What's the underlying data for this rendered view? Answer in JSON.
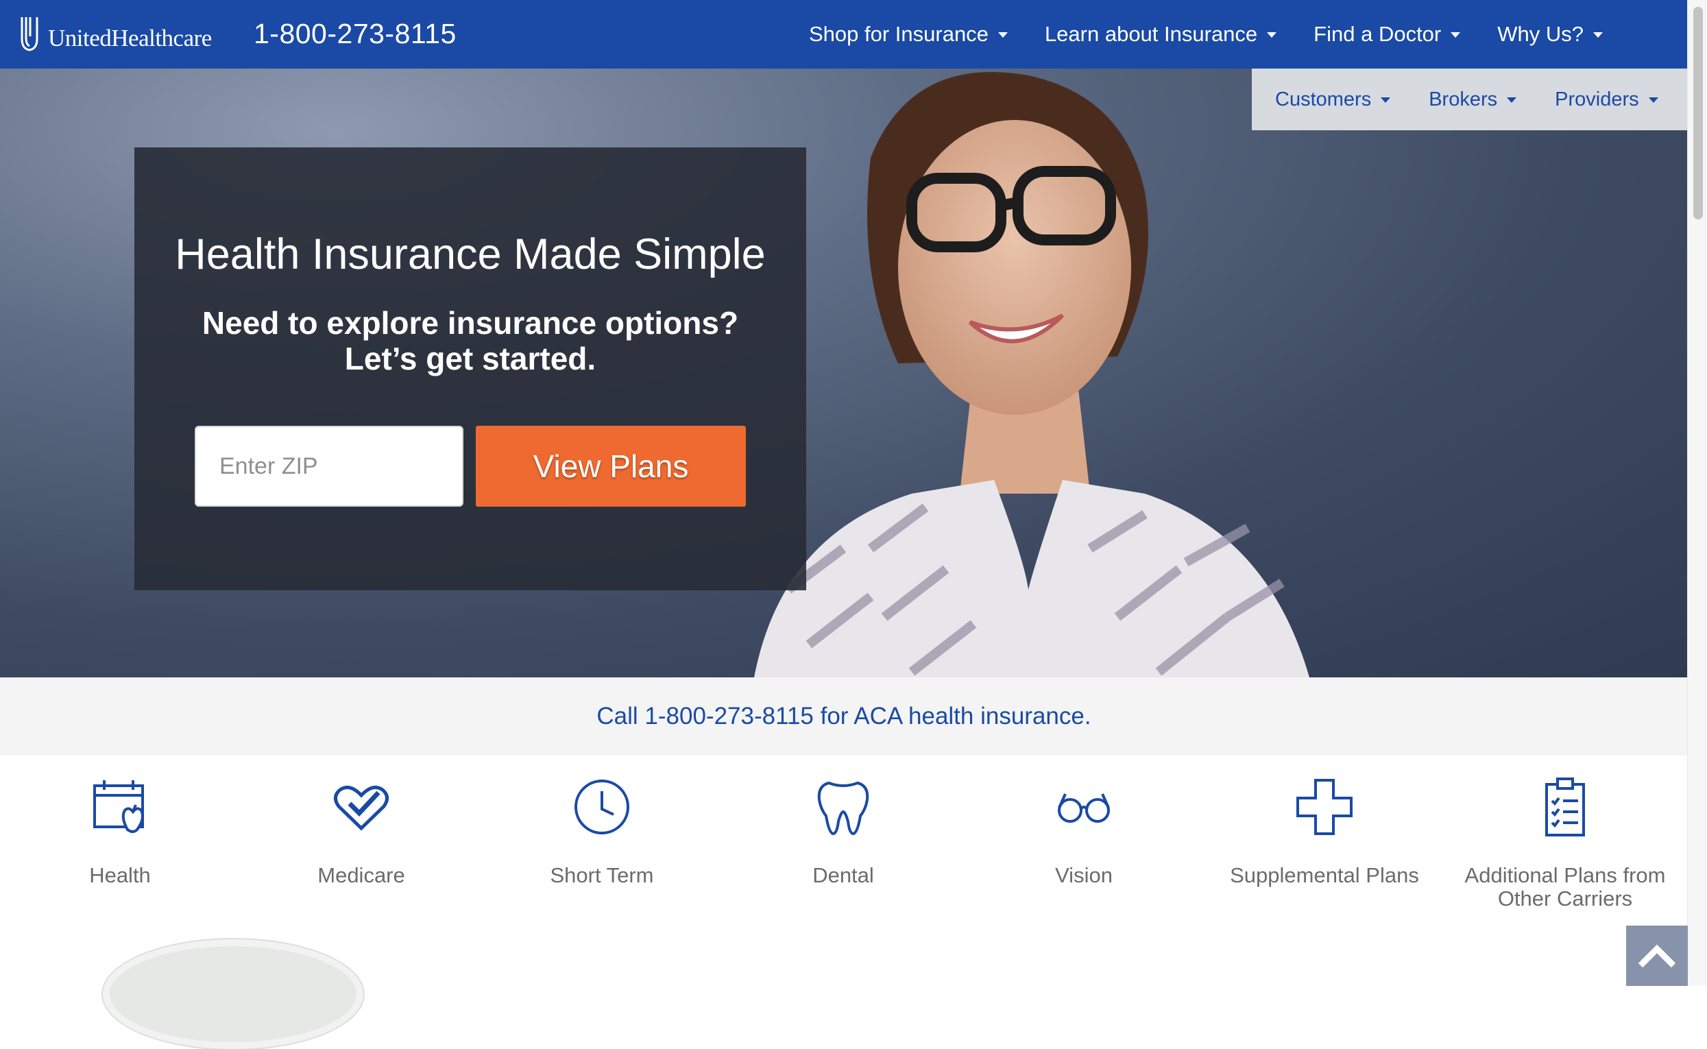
{
  "brand": {
    "name": "UnitedHealthcare",
    "logo_icon": "uhc-shield-icon"
  },
  "header": {
    "phone": "1-800-273-8115"
  },
  "main_nav": [
    {
      "label": "Shop for Insurance"
    },
    {
      "label": "Learn about Insurance"
    },
    {
      "label": "Find a Doctor"
    },
    {
      "label": "Why Us?"
    }
  ],
  "sub_nav": [
    {
      "label": "Customers"
    },
    {
      "label": "Brokers"
    },
    {
      "label": "Providers"
    }
  ],
  "hero": {
    "headline": "Health Insurance Made Simple",
    "subline_1": "Need to explore insurance options?",
    "subline_2": "Let’s get started.",
    "zip_placeholder": "Enter ZIP",
    "zip_value": "",
    "cta_label": "View Plans"
  },
  "call_strip": {
    "text": "Call 1-800-273-8115 for ACA health insurance."
  },
  "categories": [
    {
      "label": "Health",
      "icon": "calendar-apple-icon"
    },
    {
      "label": "Medicare",
      "icon": "heart-check-icon"
    },
    {
      "label": "Short Term",
      "icon": "clock-icon"
    },
    {
      "label": "Dental",
      "icon": "tooth-icon"
    },
    {
      "label": "Vision",
      "icon": "eyeglasses-icon"
    },
    {
      "label": "Supplemental Plans",
      "icon": "medical-cross-icon"
    },
    {
      "label": "Additional Plans from Other Carriers",
      "icon": "clipboard-checklist-icon"
    }
  ],
  "colors": {
    "primary": "#1a4aa5",
    "cta": "#ee6a30",
    "panel": "#282c36",
    "strip": "#f4f4f4"
  },
  "back_to_top_icon": "chevron-up-icon"
}
